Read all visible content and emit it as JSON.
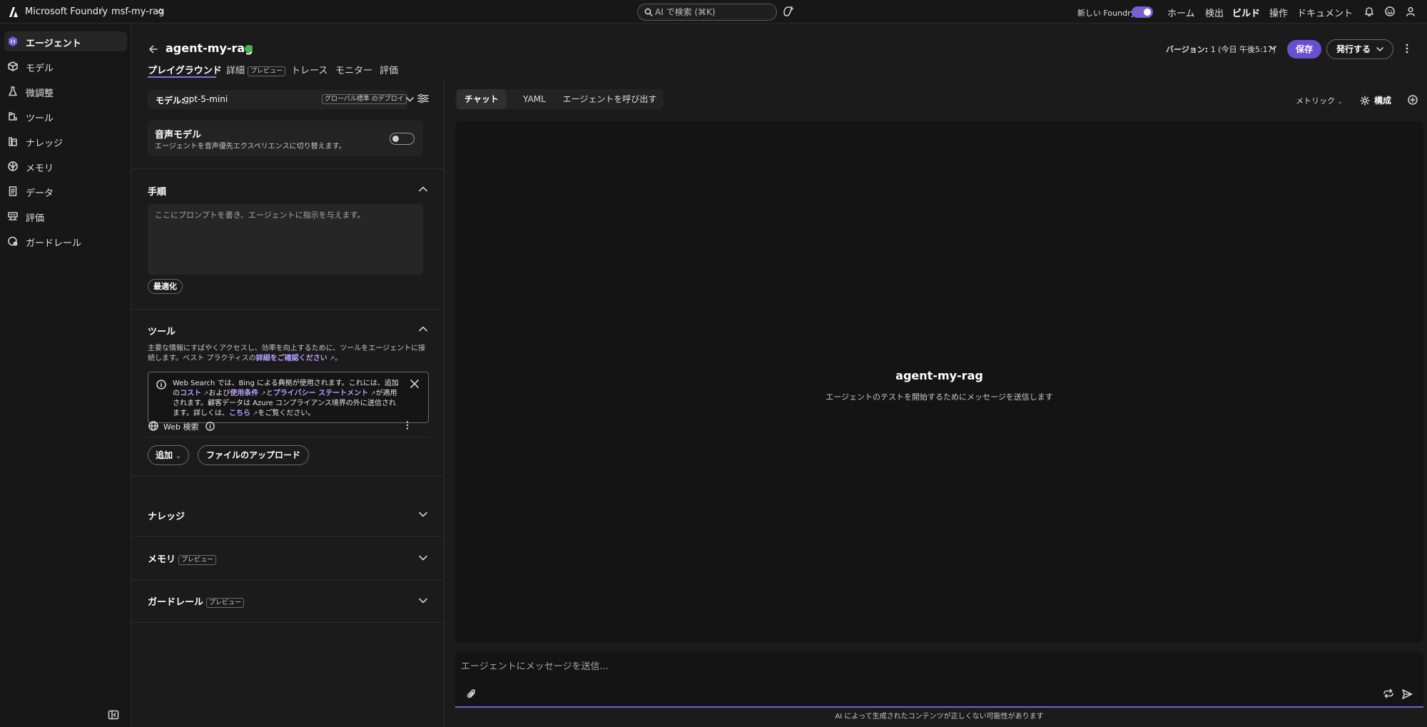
{
  "topbar": {
    "brand": "Microsoft Foundry",
    "separator": "/",
    "project": "msf-my-rag",
    "search_placeholder": "AI で検索 (⌘K)",
    "new_foundry_label": "新しい Foundry",
    "new_foundry_on": true,
    "nav": [
      "ホーム",
      "検出",
      "ビルド",
      "操作",
      "ドキュメント"
    ],
    "active_nav": "ビルド"
  },
  "sidebar": {
    "items": [
      {
        "label": "エージェント",
        "icon": "agent-icon",
        "active": true
      },
      {
        "label": "モデル",
        "icon": "cube-icon"
      },
      {
        "label": "微調整",
        "icon": "flask-icon"
      },
      {
        "label": "ツール",
        "icon": "wrench-icon"
      },
      {
        "label": "ナレッジ",
        "icon": "books-icon"
      },
      {
        "label": "メモリ",
        "icon": "brain-icon"
      },
      {
        "label": "データ",
        "icon": "document-icon"
      },
      {
        "label": "評価",
        "icon": "evaluation-icon"
      },
      {
        "label": "ガードレール",
        "icon": "shield-icon"
      }
    ]
  },
  "header": {
    "agent_name": "agent-my-rag",
    "status_color": "#3fb950",
    "version_label": "バージョン:",
    "version_value": "1 (今日 午後5:17)",
    "save_label": "保存",
    "publish_label": "発行する"
  },
  "tabs": [
    {
      "label": "プレイグラウンド",
      "active": true
    },
    {
      "label": "詳細",
      "badge": "プレビュー"
    },
    {
      "label": "トレース"
    },
    {
      "label": "モニター"
    },
    {
      "label": "評価"
    }
  ],
  "left_panel": {
    "model_label": "モデル:",
    "model_value": "gpt-5-mini",
    "deployment_badge": "グローバル標準 のデプロイ",
    "voice_title": "音声モデル",
    "voice_desc": "エージェントを音声優先エクスペリエンスに切り替えます。",
    "voice_on": false,
    "instructions_title": "手順",
    "instructions_placeholder": "ここにプロンプトを書き、エージェントに指示を与えます。",
    "optimize_label": "最適化",
    "tools_title": "ツール",
    "tools_desc_prefix": "主要な情報にすばやくアクセスし、効率を向上するために、ツールをエージェントに接続します。ベスト プラクティスの",
    "tools_desc_link": "詳細をご確認ください",
    "tools_desc_suffix": "。",
    "notice": {
      "part1": "Web Search では、Bing による典拠が使用されます。これには、追加の",
      "link_cost": "コスト",
      "part2": "および",
      "link_terms": "使用条件",
      "part3": "と",
      "link_privacy": "プライバシー ステートメント",
      "part4": "が適用されます。顧客データは Azure コンプライアンス境界の外に送信されます。詳しくは、",
      "link_here": "こちら",
      "part5": "をご覧ください。"
    },
    "web_search_label": "Web 検索",
    "add_label": "追加",
    "upload_label": "ファイルのアップロード",
    "knowledge_title": "ナレッジ",
    "memory_title": "メモリ",
    "memory_badge": "プレビュー",
    "guardrail_title": "ガードレール",
    "guardrail_badge": "プレビュー"
  },
  "chat": {
    "tabs": [
      "チャット",
      "YAML",
      "エージェントを呼び出す"
    ],
    "active_tab": "チャット",
    "metrics_label": "メトリック",
    "config_label": "構成",
    "empty_title": "agent-my-rag",
    "empty_desc": "エージェントのテストを開始するためにメッセージを送信します",
    "input_placeholder": "エージェントにメッセージを送信...",
    "disclaimer": "AI によって生成されたコンテンツが正しくない可能性があります"
  },
  "colors": {
    "accent": "#7b5cd6",
    "save_button": "#6b4fd0",
    "link": "#b7a1ff",
    "background": "#1b1b1b"
  }
}
